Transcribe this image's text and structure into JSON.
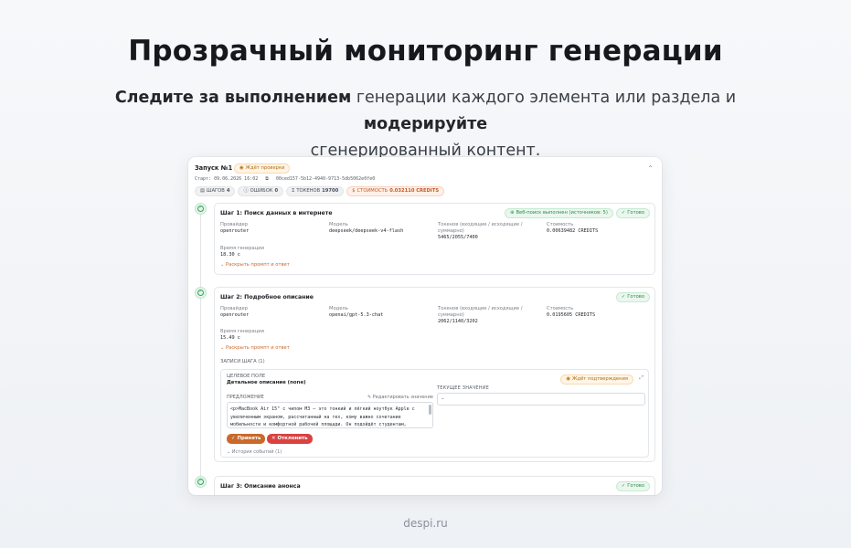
{
  "hero": {
    "title": "Прозрачный мониторинг генерации",
    "sub_bold1": "Следите за выполнением",
    "sub_text1": " генерации каждого элемента или раздела и ",
    "sub_bold2": "модерируйте",
    "sub_text2": "сгенерированный контент."
  },
  "run": {
    "title": "Запуск №1",
    "status": "Ждёт проверки",
    "started": "Старт: 09.06.2026 16:02",
    "id": "00ced157-5b12-4940-9713-5db5062e0fe0",
    "steps_label": "ШАГОВ",
    "steps_count": "4",
    "errors_label": "ОШИБОК",
    "errors_count": "0",
    "tokens_label": "ТОКЕНОВ",
    "tokens_count": "19700",
    "cost_label": "СТОИМОСТЬ",
    "cost_value": "0.032110 CREDITS"
  },
  "labels": {
    "provider": "Провайдер",
    "model": "Модель",
    "tokens": "Токенов (входящие / исходящие / суммарно)",
    "cost": "Стоимость",
    "gen_time": "Время генерации",
    "expand": "Раскрыть промпт и ответ",
    "done": "Готово"
  },
  "steps": [
    {
      "title": "Шаг 1: Поиск данных в интернете",
      "extra_badge": "Веб-поиск выполнен (источников: 5)",
      "provider": "openrouter",
      "model": "deepseek/deepseek-v4-flash",
      "tokens": "5465/2055/7400",
      "cost": "0.00639482 CREDITS",
      "time": "18.30 с"
    },
    {
      "title": "Шаг 2: Подробное описание",
      "provider": "openrouter",
      "model": "openai/gpt-5.3-chat",
      "tokens": "2062/1140/3202",
      "cost": "0.0195605 CREDITS",
      "time": "15.49 с"
    },
    {
      "title": "Шаг 3: Описание анонса"
    }
  ],
  "record": {
    "section_title": "ЗАПИСИ ШАГА (1)",
    "field_label": "ЦЕЛЕВОЕ ПОЛЕ",
    "field_name": "Детальное описание (none)",
    "status": "Ждёт подтверждения",
    "suggestion_label": "ПРЕДЛОЖЕНИЕ",
    "edit_link": "Редактировать значение",
    "current_label": "ТЕКУЩЕЕ ЗНАЧЕНИЕ",
    "current_value": "–",
    "suggestion_text": "<p>MacBook Air 15\" с чипом M3 — это тонкий и лёгкий ноутбук Apple с увеличенным экраном, рассчитанный на тех, кому важно сочетание мобильности и комфортной рабочей площади. Он подойдёт студентам, специалистам и творческим пользователям, которым нужен большой экран",
    "accept": "Принять",
    "reject": "Отклонить",
    "history": "История событий (1)"
  },
  "footer": "despi.ru"
}
